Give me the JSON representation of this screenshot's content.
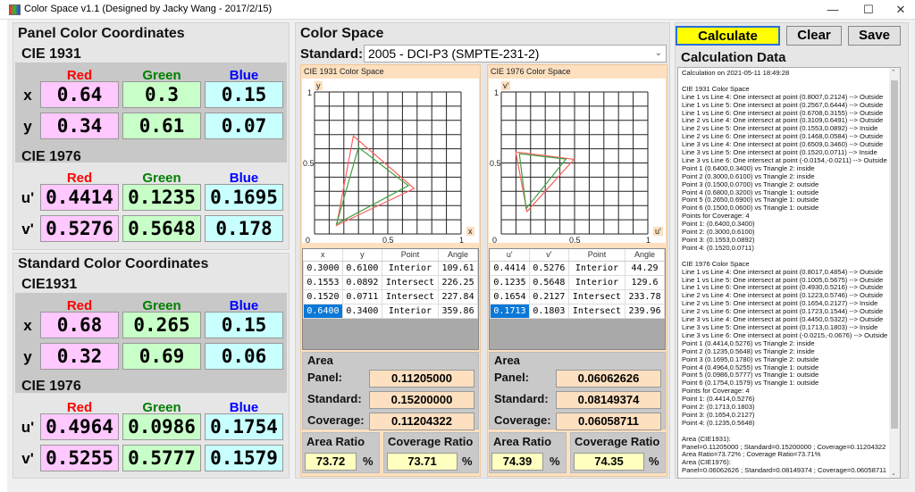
{
  "window": {
    "title": "Color Space v1.1  (Designed by Jacky Wang - 2017/2/15)",
    "minimize": "—",
    "maximize": "☐",
    "close": "✕"
  },
  "colors": {
    "red_label": "#ff0000",
    "green_label": "#008000",
    "blue_label": "#0000ff",
    "red_cell": "#ffc8ff",
    "green_cell": "#c8ffc8",
    "blue_cell": "#c8ffff",
    "standard_line": "#ff6060",
    "panel_line": "#40a040",
    "calculate_button": "#ffff00"
  },
  "panel": {
    "title": "Panel Color Coordinates",
    "cie1931": {
      "label": "CIE 1931",
      "headers": [
        "Red",
        "Green",
        "Blue"
      ],
      "rows": [
        {
          "label": "x",
          "values": [
            "0.64",
            "0.3",
            "0.15"
          ]
        },
        {
          "label": "y",
          "values": [
            "0.34",
            "0.61",
            "0.07"
          ]
        }
      ]
    },
    "cie1976": {
      "label": "CIE 1976",
      "headers": [
        "Red",
        "Green",
        "Blue"
      ],
      "rows": [
        {
          "label": "u'",
          "values": [
            "0.4414",
            "0.1235",
            "0.1695"
          ]
        },
        {
          "label": "v'",
          "values": [
            "0.5276",
            "0.5648",
            "0.178"
          ]
        }
      ]
    }
  },
  "standard": {
    "title": "Standard Color Coordinates",
    "cie1931": {
      "label": "CIE1931",
      "headers": [
        "Red",
        "Green",
        "Blue"
      ],
      "rows": [
        {
          "label": "x",
          "values": [
            "0.68",
            "0.265",
            "0.15"
          ]
        },
        {
          "label": "y",
          "values": [
            "0.32",
            "0.69",
            "0.06"
          ]
        }
      ]
    },
    "cie1976": {
      "label": "CIE 1976",
      "headers": [
        "Red",
        "Green",
        "Blue"
      ],
      "rows": [
        {
          "label": "u'",
          "values": [
            "0.4964",
            "0.0986",
            "0.1754"
          ]
        },
        {
          "label": "v'",
          "values": [
            "0.5255",
            "0.5777",
            "0.1579"
          ]
        }
      ]
    }
  },
  "colorspace": {
    "title": "Color Space",
    "standard_label": "Standard:",
    "standard_value": "2005 - DCI-P3 (SMPTE-231-2)",
    "cie1931": {
      "title": "CIE 1931 Color Space",
      "xlabel": "x",
      "ylabel": "y",
      "ticks": [
        "0",
        "0.5",
        "1"
      ],
      "panel_triangle": [
        [
          0.64,
          0.34
        ],
        [
          0.3,
          0.61
        ],
        [
          0.15,
          0.07
        ]
      ],
      "standard_triangle": [
        [
          0.68,
          0.32
        ],
        [
          0.265,
          0.69
        ],
        [
          0.15,
          0.06
        ]
      ],
      "table": {
        "headers": [
          "x",
          "y",
          "Point",
          "Angle"
        ],
        "rows": [
          [
            "0.3000",
            "0.6100",
            "Interior",
            "109.61"
          ],
          [
            "0.1553",
            "0.0892",
            "Intersect",
            "226.25"
          ],
          [
            "0.1520",
            "0.0711",
            "Intersect",
            "227.84"
          ],
          [
            "0.6400",
            "0.3400",
            "Interior",
            "359.86"
          ]
        ]
      },
      "area": {
        "title": "Area",
        "panel_label": "Panel:",
        "panel": "0.11205000",
        "standard_label": "Standard:",
        "standard": "0.15200000",
        "coverage_label": "Coverage:",
        "coverage": "0.11204322"
      },
      "area_ratio_label": "Area Ratio",
      "area_ratio": "73.72",
      "coverage_ratio_label": "Coverage Ratio",
      "coverage_ratio": "73.71",
      "pct": "%"
    },
    "cie1976": {
      "title": "CIE 1976 Color Space",
      "xlabel": "u'",
      "ylabel": "v'",
      "ticks": [
        "0",
        "0.5",
        "1"
      ],
      "panel_triangle": [
        [
          0.4414,
          0.5276
        ],
        [
          0.1235,
          0.5648
        ],
        [
          0.1695,
          0.178
        ]
      ],
      "standard_triangle": [
        [
          0.4964,
          0.5255
        ],
        [
          0.0986,
          0.5777
        ],
        [
          0.1754,
          0.1579
        ]
      ],
      "table": {
        "headers": [
          "u'",
          "v'",
          "Point",
          "Angle"
        ],
        "rows": [
          [
            "0.4414",
            "0.5276",
            "Interior",
            "44.29"
          ],
          [
            "0.1235",
            "0.5648",
            "Interior",
            "129.6"
          ],
          [
            "0.1654",
            "0.2127",
            "Intersect",
            "233.78"
          ],
          [
            "0.1713",
            "0.1803",
            "Intersect",
            "239.96"
          ]
        ]
      },
      "area": {
        "title": "Area",
        "panel_label": "Panel:",
        "panel": "0.06062626",
        "standard_label": "Standard:",
        "standard": "0.08149374",
        "coverage_label": "Coverage:",
        "coverage": "0.06058711"
      },
      "area_ratio_label": "Area Ratio",
      "area_ratio": "74.39",
      "coverage_ratio_label": "Coverage Ratio",
      "coverage_ratio": "74.35",
      "pct": "%"
    }
  },
  "buttons": {
    "calculate": "Calculate",
    "clear": "Clear",
    "save": "Save"
  },
  "calc": {
    "title": "Calculation Data",
    "lines": [
      "Calculation on 2021-05-11 18:49:28",
      "",
      "CIE 1931 Color Space",
      "Line 1 vs Line 4: One intersect at point (0.8007,0.2124) --> Outside",
      "Line 1 vs Line 5: One intersect at point (0.2567,0.6444) --> Outside",
      "Line 1 vs Line 6: One intersect at point (0.6708,0.3155) --> Outside",
      "Line 2 vs Line 4: One intersect at point (0.3109,0.6491) --> Outside",
      "Line 2 vs Line 5: One intersect at point (0.1553,0.0892) --> Inside",
      "Line 2 vs Line 6: One intersect at point (0.1468,0.0584) --> Outside",
      "Line 3 vs Line 4: One intersect at point (0.6509,0.3460) --> Outside",
      "Line 3 vs Line 5: One intersect at point (0.1520,0.0711) --> Inside",
      "Line 3 vs Line 6: One intersect at point (-0.0154,-0.0211) --> Outside",
      "Point 1 (0.6400,0.3400) vs Triangle 2: inside",
      "Point 2 (0.3000,0.6100) vs Triangle 2: inside",
      "Point 3 (0.1500,0.0700) vs Triangle 2: outside",
      "Point 4 (0.6800,0.3200) vs Triangle 1: outside",
      "Point 5 (0.2650,0.6900) vs Triangle 1: outside",
      "Point 6 (0.1500,0.0600) vs Triangle 1: outside",
      "Points for Coverage: 4",
      "Point 1: (0.6400,0.3400)",
      "Point 2: (0.3000,0.6100)",
      "Point 3: (0.1553,0.0892)",
      "Point 4: (0.1520,0.0711)",
      "",
      "CIE 1976 Color Space",
      "Line 1 vs Line 4: One intersect at point (0.8017,0.4854) --> Outside",
      "Line 1 vs Line 5: One intersect at point (0.1005,0.5675) --> Outside",
      "Line 1 vs Line 6: One intersect at point (0.4930,0.5216) --> Outside",
      "Line 2 vs Line 4: One intersect at point (0.1223,0.5746) --> Outside",
      "Line 2 vs Line 5: One intersect at point (0.1654,0.2127) --> Inside",
      "Line 2 vs Line 6: One intersect at point (0.1723,0.1544) --> Outside",
      "Line 3 vs Line 4: One intersect at point (0.4450,0.5322) --> Outside",
      "Line 3 vs Line 5: One intersect at point (0.1713,0.1803) --> Inside",
      "Line 3 vs Line 6: One intersect at point (-0.0215,-0.0676) --> Outside",
      "Point 1 (0.4414,0.5276) vs Triangle 2: inside",
      "Point 2 (0.1235,0.5648) vs Triangle 2: inside",
      "Point 3 (0.1695,0.1780) vs Triangle 2: outside",
      "Point 4 (0.4964,0.5255) vs Triangle 1: outside",
      "Point 5 (0.0986,0.5777) vs Triangle 1: outside",
      "Point 6 (0.1754,0.1579) vs Triangle 1: outside",
      "Points for Coverage: 4",
      "Point 1: (0.4414,0.5276)",
      "Point 2: (0.1713,0.1803)",
      "Point 3: (0.1654,0.2127)",
      "Point 4: (0.1235,0.5648)",
      "",
      "Area (CIE1931):",
      "Panel=0.11205000 ; Standard=0.15200000 ; Coverage=0.11204322",
      "Area Ratio=73.72% ; Coverage Ratio=73.71%",
      "Area (CIE1976):",
      "Panel=0.06062626 ; Standard=0.08149374 ; Coverage=0.06058711"
    ]
  }
}
